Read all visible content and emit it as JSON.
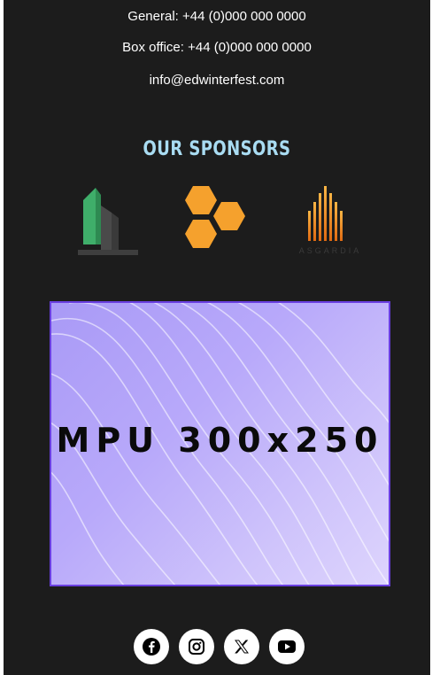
{
  "contact": {
    "general": "General: +44 (0)000 000 0000",
    "box_office": "Box office: +44 (0)000 000 0000",
    "email": "info@edwinterfest.com"
  },
  "sponsors": {
    "title": "OUR SPONSORS",
    "logos": [
      {
        "icon": "green-building-logo-icon"
      },
      {
        "icon": "orange-hexagons-logo-icon"
      },
      {
        "icon": "asgardia-logo-icon",
        "text": "ASGARDIA"
      }
    ]
  },
  "ad": {
    "label": "MPU 300x250"
  },
  "social": [
    {
      "icon": "facebook-icon"
    },
    {
      "icon": "instagram-icon"
    },
    {
      "icon": "x-icon"
    },
    {
      "icon": "youtube-icon"
    }
  ],
  "colors": {
    "background": "#1c1c1c",
    "sponsors_title": "#a9dcf2",
    "ad_border": "#6a3fe0"
  }
}
